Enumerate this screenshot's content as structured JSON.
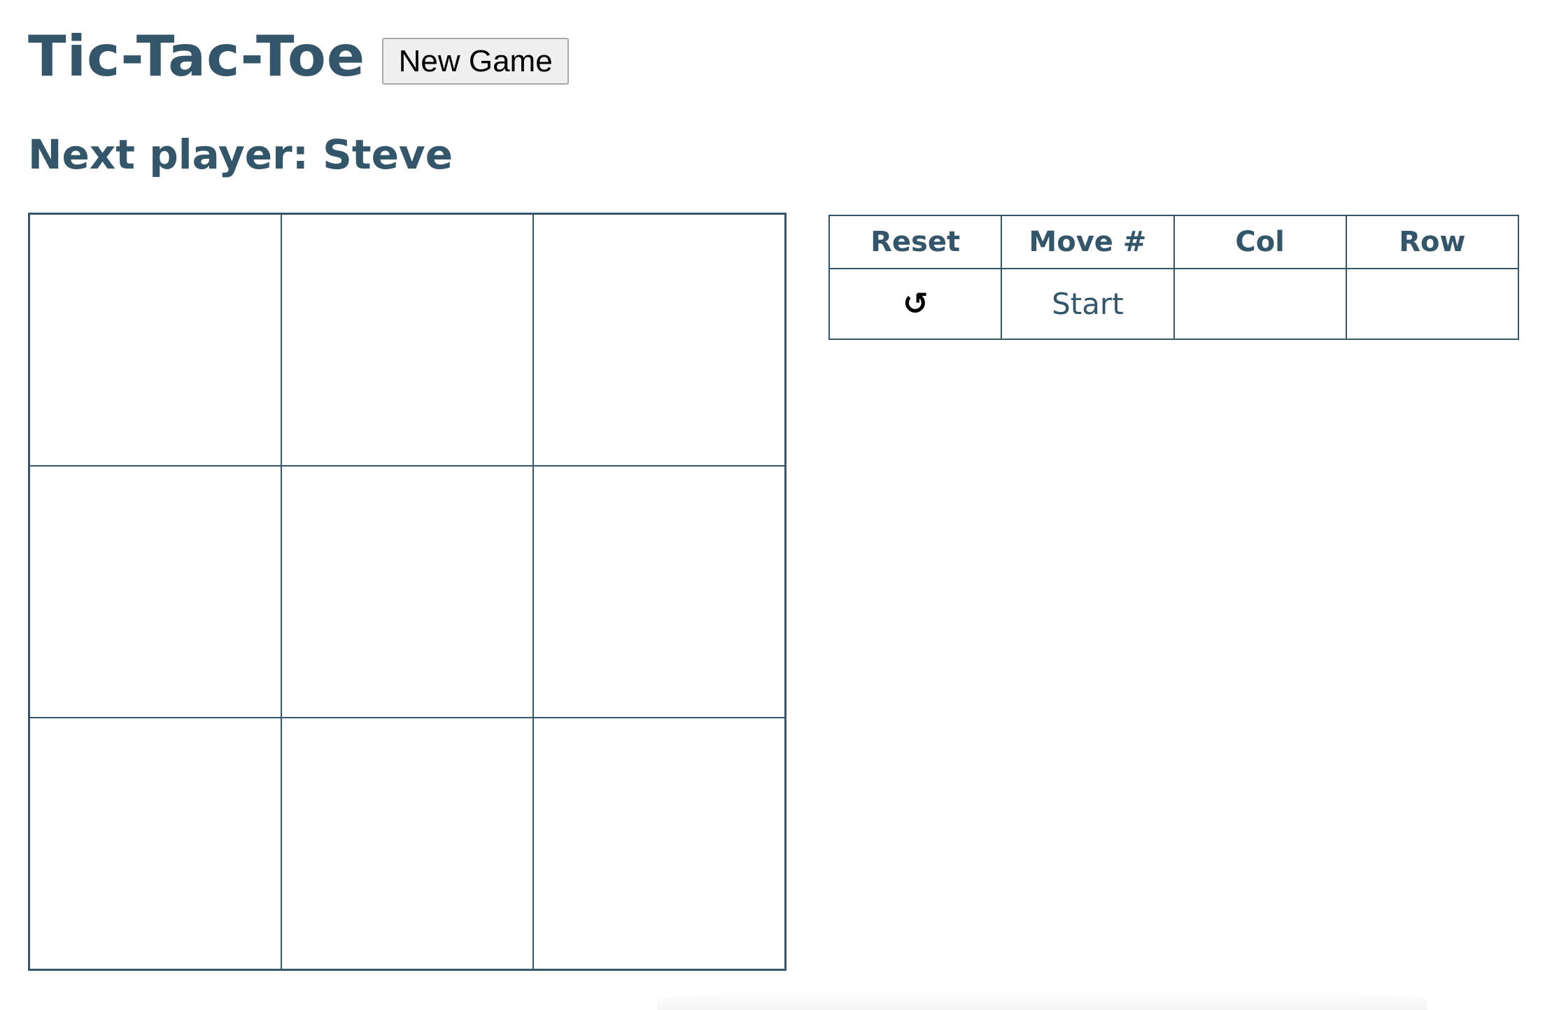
{
  "header": {
    "title": "Tic-Tac-Toe",
    "new_game_label": "New Game"
  },
  "status": {
    "text": "Next player: Steve"
  },
  "board": {
    "squares": [
      "",
      "",
      "",
      "",
      "",
      "",
      "",
      "",
      ""
    ]
  },
  "history": {
    "columns": [
      "Reset",
      "Move #",
      "Col",
      "Row"
    ],
    "rows": [
      {
        "reset_icon": "reset-icon",
        "move": "Start",
        "col": "",
        "row": ""
      }
    ]
  },
  "colors": {
    "primary": "#34566a",
    "button_bg": "#efefef",
    "button_border": "#a9a9a9"
  },
  "icons": {
    "reset": "reset-icon",
    "reset_glyph": "↻"
  }
}
